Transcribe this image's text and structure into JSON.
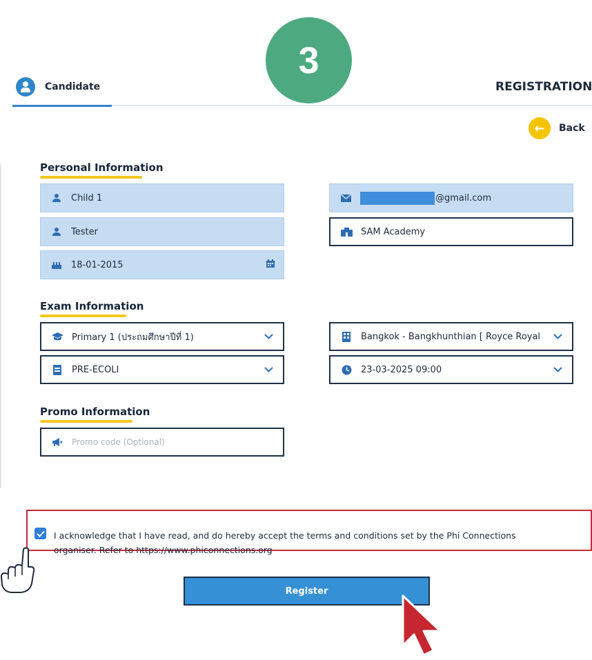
{
  "step_number": "3",
  "header": {
    "tab_label": "Candidate",
    "page_title": "REGISTRATION",
    "back_label": "Back"
  },
  "personal": {
    "section_title": "Personal Information",
    "first_name": "Child 1",
    "last_name": "Tester",
    "birth_date": "18-01-2015",
    "email_suffix": "@gmail.com",
    "school": "SAM Academy"
  },
  "exam": {
    "section_title": "Exam Information",
    "grade": "Primary 1 (ประถมศึกษาปีที่ 1)",
    "exam_type": "PRE-ECOLI",
    "venue": "Bangkok - Bangkhunthian [ Royce Royal",
    "datetime": "23-03-2025 09:00"
  },
  "promo": {
    "section_title": "Promo Information",
    "placeholder": "Promo code (Optional)"
  },
  "consent": {
    "line1": "I acknowledge that I have read, and do hereby accept the terms and conditions set by the Phi Connections",
    "line2": "organiser. Refer to https://www.phiconnections.org",
    "checked": true
  },
  "register_label": "Register",
  "colors": {
    "accent_blue": "#2f86c8",
    "field_fill": "#c6dcf3",
    "highlight_yellow": "#f3c81f",
    "badge_green": "#4daa80",
    "emphasis_red": "#c5283d"
  }
}
